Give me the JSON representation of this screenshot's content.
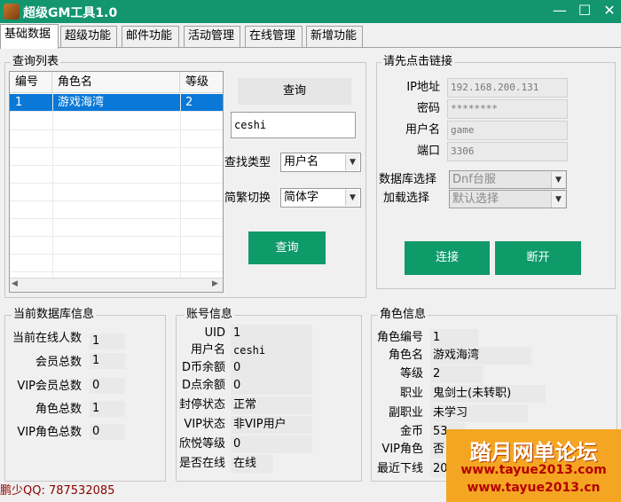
{
  "window": {
    "title": "超级GM工具1.0",
    "minimize": "—",
    "maximize": "☐",
    "close": "✕"
  },
  "tabs": [
    "基础数据",
    "超级功能",
    "邮件功能",
    "活动管理",
    "在线管理",
    "新增功能"
  ],
  "query_list": {
    "title": "查询列表",
    "columns": [
      "编号",
      "角色名",
      "等级"
    ],
    "rows": [
      {
        "id": "1",
        "name": "游戏海湾",
        "level": "2"
      }
    ],
    "scroll_left": "◀",
    "scroll_right": "▶"
  },
  "search": {
    "top_button": "查询",
    "input_value": "ceshi",
    "type_label": "查找类型",
    "type_value": "用户名",
    "convert_label": "简繁切换",
    "convert_value": "简体字",
    "query_button": "查询"
  },
  "connection": {
    "title": "请先点击链接",
    "ip_label": "IP地址",
    "ip_value": "192.168.200.131",
    "password_label": "密码",
    "password_value": "********",
    "user_label": "用户名",
    "user_value": "game",
    "port_label": "端口",
    "port_value": "3306",
    "db_label": "数据库选择",
    "db_value": "Dnf台服",
    "load_label": "加载选择",
    "load_value": "默认选择",
    "connect_button": "连接",
    "disconnect_button": "断开"
  },
  "db_info": {
    "title": "当前数据库信息",
    "items": [
      {
        "label": "当前在线人数",
        "value": "1"
      },
      {
        "label": "会员总数",
        "value": "1"
      },
      {
        "label": "VIP会员总数",
        "value": "0"
      },
      {
        "label": "角色总数",
        "value": "1"
      },
      {
        "label": "VIP角色总数",
        "value": "0"
      }
    ]
  },
  "account_info": {
    "title": "账号信息",
    "items": [
      {
        "label": "UID",
        "value": "1"
      },
      {
        "label": "用户名",
        "value": "ceshi"
      },
      {
        "label": "D币余额",
        "value": "0"
      },
      {
        "label": "D点余额",
        "value": "0"
      },
      {
        "label": "封停状态",
        "value": "正常"
      },
      {
        "label": "VIP状态",
        "value": "非VIP用户"
      },
      {
        "label": "欣悦等级",
        "value": "0"
      },
      {
        "label": "是否在线",
        "value": "在线"
      }
    ]
  },
  "role_info": {
    "title": "角色信息",
    "items": [
      {
        "label": "角色编号",
        "value": "1"
      },
      {
        "label": "角色名",
        "value": "游戏海湾"
      },
      {
        "label": "等级",
        "value": "2"
      },
      {
        "label": "职业",
        "value": "鬼剑士(未转职)"
      },
      {
        "label": "副职业",
        "value": "未学习"
      },
      {
        "label": "金币",
        "value": "53"
      },
      {
        "label": "VIP角色",
        "value": "否"
      },
      {
        "label": "最近下线",
        "value": "20"
      }
    ]
  },
  "footer": {
    "qq": "鹏少QQ: 787532085"
  },
  "watermark": {
    "name": "踏月网单论坛",
    "url1": "www.tayue2013.com",
    "url2": "www.tayue2013.cn"
  }
}
